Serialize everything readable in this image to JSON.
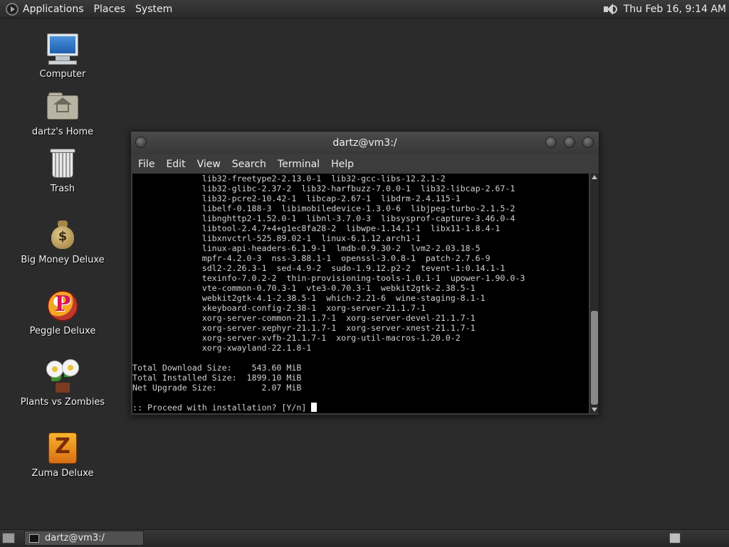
{
  "top_panel": {
    "menus": [
      "Applications",
      "Places",
      "System"
    ],
    "clock": "Thu Feb 16,  9:14 AM"
  },
  "desktop_icons": [
    {
      "label": "Computer",
      "icon": "computer-icon"
    },
    {
      "label": "dartz's Home",
      "icon": "home-folder-icon"
    },
    {
      "label": "Trash",
      "icon": "trash-icon"
    },
    {
      "label": "Big Money Deluxe",
      "icon": "money-bag-icon"
    },
    {
      "label": "Peggle Deluxe",
      "icon": "peggle-icon"
    },
    {
      "label": "Plants vs Zombies",
      "icon": "plants-vs-zombies-icon"
    },
    {
      "label": "Zuma Deluxe",
      "icon": "zuma-icon"
    }
  ],
  "terminal": {
    "title": "dartz@vm3:/",
    "menu": [
      "File",
      "Edit",
      "View",
      "Search",
      "Terminal",
      "Help"
    ],
    "lines": [
      "              lib32-freetype2-2.13.0-1  lib32-gcc-libs-12.2.1-2",
      "              lib32-glibc-2.37-2  lib32-harfbuzz-7.0.0-1  lib32-libcap-2.67-1",
      "              lib32-pcre2-10.42-1  libcap-2.67-1  libdrm-2.4.115-1",
      "              libelf-0.188-3  libimobiledevice-1.3.0-6  libjpeg-turbo-2.1.5-2",
      "              libnghttp2-1.52.0-1  libnl-3.7.0-3  libsysprof-capture-3.46.0-4",
      "              libtool-2.4.7+4+g1ec8fa28-2  libwpe-1.14.1-1  libx11-1.8.4-1",
      "              libxnvctrl-525.89.02-1  linux-6.1.12.arch1-1",
      "              linux-api-headers-6.1.9-1  lmdb-0.9.30-2  lvm2-2.03.18-5",
      "              mpfr-4.2.0-3  nss-3.88.1-1  openssl-3.0.8-1  patch-2.7.6-9",
      "              sdl2-2.26.3-1  sed-4.9-2  sudo-1.9.12.p2-2  tevent-1:0.14.1-1",
      "              texinfo-7.0.2-2  thin-provisioning-tools-1.0.1-1  upower-1.90.0-3",
      "              vte-common-0.70.3-1  vte3-0.70.3-1  webkit2gtk-2.38.5-1",
      "              webkit2gtk-4.1-2.38.5-1  which-2.21-6  wine-staging-8.1-1",
      "              xkeyboard-config-2.38-1  xorg-server-21.1.7-1",
      "              xorg-server-common-21.1.7-1  xorg-server-devel-21.1.7-1",
      "              xorg-server-xephyr-21.1.7-1  xorg-server-xnest-21.1.7-1",
      "              xorg-server-xvfb-21.1.7-1  xorg-util-macros-1.20.0-2",
      "              xorg-xwayland-22.1.8-1",
      "",
      "Total Download Size:    543.60 MiB",
      "Total Installed Size:  1899.10 MiB",
      "Net Upgrade Size:         2.07 MiB",
      ""
    ],
    "prompt": ":: Proceed with installation? [Y/n] "
  },
  "bottom_panel": {
    "task_label": "dartz@vm3:/"
  }
}
